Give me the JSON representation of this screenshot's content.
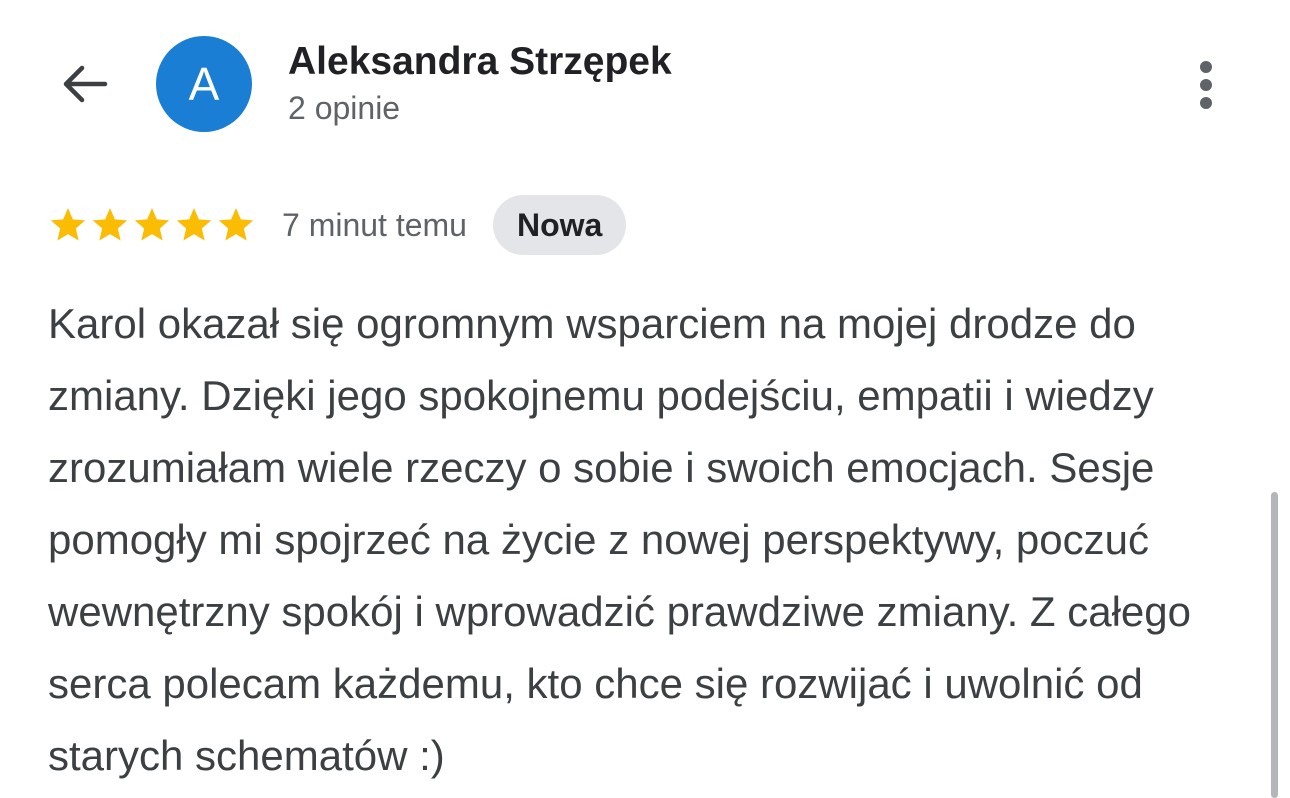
{
  "header": {
    "back_icon": "arrow-back-icon",
    "avatar_initial": "A",
    "avatar_color": "#1a7fd4",
    "reviewer_name": "Aleksandra Strzępek",
    "review_count": "2 opinie",
    "more_icon": "more-vertical-icon"
  },
  "review": {
    "rating": 5,
    "rating_max": 5,
    "star_color": "#fbbc04",
    "time_ago": "7 minut temu",
    "badge": "Nowa",
    "text": "Karol okazał się ogromnym wsparciem na mojej drodze do zmiany. Dzięki jego spokojnemu podejściu, empatii i wiedzy zrozumiałam wiele rzeczy o sobie i swoich emocjach. Sesje pomogły mi spojrzeć na życie z nowej perspektywy, poczuć wewnętrzny spokój i wprowadzić prawdziwe zmiany. Z całego serca polecam każdemu, kto chce się rozwijać i uwolnić od starych schematów :)"
  }
}
